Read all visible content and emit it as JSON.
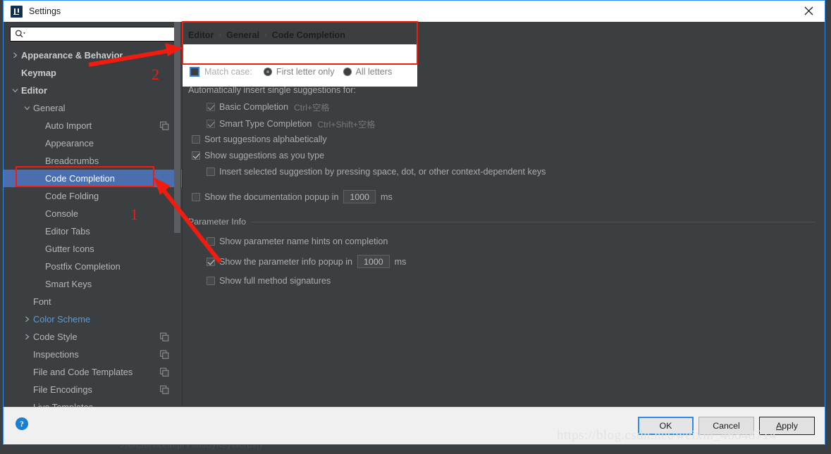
{
  "window": {
    "title": "Settings",
    "logo_icon": "intellij-idea-logo-icon",
    "close_icon": "close-icon"
  },
  "search": {
    "value": "",
    "placeholder": "",
    "icon": "search-icon",
    "dropdown_icon": "chevron-down-icon"
  },
  "sidebar": {
    "items": [
      {
        "label": "Appearance & Behavior",
        "indent": 0,
        "arrow": "collapsed",
        "bold": true,
        "link": false,
        "selected": false,
        "copy": false
      },
      {
        "label": "Keymap",
        "indent": 0,
        "arrow": "none",
        "bold": true,
        "link": false,
        "selected": false,
        "copy": false
      },
      {
        "label": "Editor",
        "indent": 0,
        "arrow": "expanded",
        "bold": true,
        "link": false,
        "selected": false,
        "copy": false
      },
      {
        "label": "General",
        "indent": 1,
        "arrow": "expanded",
        "bold": false,
        "link": false,
        "selected": false,
        "copy": false
      },
      {
        "label": "Auto Import",
        "indent": 2,
        "arrow": "none",
        "bold": false,
        "link": false,
        "selected": false,
        "copy": true
      },
      {
        "label": "Appearance",
        "indent": 2,
        "arrow": "none",
        "bold": false,
        "link": false,
        "selected": false,
        "copy": false
      },
      {
        "label": "Breadcrumbs",
        "indent": 2,
        "arrow": "none",
        "bold": false,
        "link": false,
        "selected": false,
        "copy": false
      },
      {
        "label": "Code Completion",
        "indent": 2,
        "arrow": "none",
        "bold": false,
        "link": false,
        "selected": true,
        "copy": false
      },
      {
        "label": "Code Folding",
        "indent": 2,
        "arrow": "none",
        "bold": false,
        "link": false,
        "selected": false,
        "copy": false
      },
      {
        "label": "Console",
        "indent": 2,
        "arrow": "none",
        "bold": false,
        "link": false,
        "selected": false,
        "copy": false
      },
      {
        "label": "Editor Tabs",
        "indent": 2,
        "arrow": "none",
        "bold": false,
        "link": false,
        "selected": false,
        "copy": false
      },
      {
        "label": "Gutter Icons",
        "indent": 2,
        "arrow": "none",
        "bold": false,
        "link": false,
        "selected": false,
        "copy": false
      },
      {
        "label": "Postfix Completion",
        "indent": 2,
        "arrow": "none",
        "bold": false,
        "link": false,
        "selected": false,
        "copy": false
      },
      {
        "label": "Smart Keys",
        "indent": 2,
        "arrow": "none",
        "bold": false,
        "link": false,
        "selected": false,
        "copy": false
      },
      {
        "label": "Font",
        "indent": 1,
        "arrow": "none",
        "bold": false,
        "link": false,
        "selected": false,
        "copy": false
      },
      {
        "label": "Color Scheme",
        "indent": 1,
        "arrow": "collapsed",
        "bold": false,
        "link": true,
        "selected": false,
        "copy": false
      },
      {
        "label": "Code Style",
        "indent": 1,
        "arrow": "collapsed",
        "bold": false,
        "link": false,
        "selected": false,
        "copy": true
      },
      {
        "label": "Inspections",
        "indent": 1,
        "arrow": "none",
        "bold": false,
        "link": false,
        "selected": false,
        "copy": true
      },
      {
        "label": "File and Code Templates",
        "indent": 1,
        "arrow": "none",
        "bold": false,
        "link": false,
        "selected": false,
        "copy": true
      },
      {
        "label": "File Encodings",
        "indent": 1,
        "arrow": "none",
        "bold": false,
        "link": false,
        "selected": false,
        "copy": true
      },
      {
        "label": "Live Templates",
        "indent": 1,
        "arrow": "none",
        "bold": false,
        "link": false,
        "selected": false,
        "copy": false
      }
    ]
  },
  "breadcrumb": {
    "part1": "Editor",
    "sep1": "›",
    "part2": "General",
    "sep2": "›",
    "part3": "Code Completion"
  },
  "main": {
    "match_case": {
      "label": "Match case:",
      "checked": false,
      "radios": [
        {
          "label": "First letter only",
          "selected": true
        },
        {
          "label": "All letters",
          "selected": false
        }
      ]
    },
    "auto_insert_label": "Automatically insert single suggestions for:",
    "options": [
      {
        "label": "Basic Completion",
        "shortcut": "Ctrl+空格",
        "checked": true,
        "dim": true
      },
      {
        "label": "Smart Type Completion",
        "shortcut": "Ctrl+Shift+空格",
        "checked": true,
        "dim": true
      },
      {
        "label": "Sort suggestions alphabetically",
        "shortcut": "",
        "checked": false,
        "dim": false
      },
      {
        "label": "Show suggestions as you type",
        "shortcut": "",
        "checked": true,
        "dim": false
      },
      {
        "label": "Insert selected suggestion by pressing space, dot, or other context-dependent keys",
        "shortcut": "",
        "checked": false,
        "dim": false
      }
    ],
    "doc_popup": {
      "label": "Show the documentation popup in",
      "checked": false,
      "value": "1000",
      "unit": "ms"
    },
    "parameter_info": {
      "group_title": "Parameter Info",
      "hints": {
        "label": "Show parameter name hints on completion",
        "checked": false
      },
      "popup": {
        "label": "Show the parameter info popup in",
        "checked": true,
        "value": "1000",
        "unit": "ms"
      },
      "signatures": {
        "label": "Show full method signatures",
        "checked": false
      }
    }
  },
  "footer": {
    "help_icon": "help-question-icon",
    "help_label": "?",
    "buttons": [
      {
        "label": "OK",
        "style": "primary"
      },
      {
        "label": "Cancel",
        "style": "normal"
      },
      {
        "label": "Apply",
        "style": "apply",
        "mnemonic": "A"
      }
    ]
  },
  "watermark": {
    "text": "https://blog.csdn.net/weixin_46848714"
  },
  "background_ghost": {
    "text": "JsonServiceImpl  ›  findByKeyWords()"
  },
  "annotations": {
    "marker1": "1",
    "marker2": "2",
    "color": "#f01c10"
  }
}
